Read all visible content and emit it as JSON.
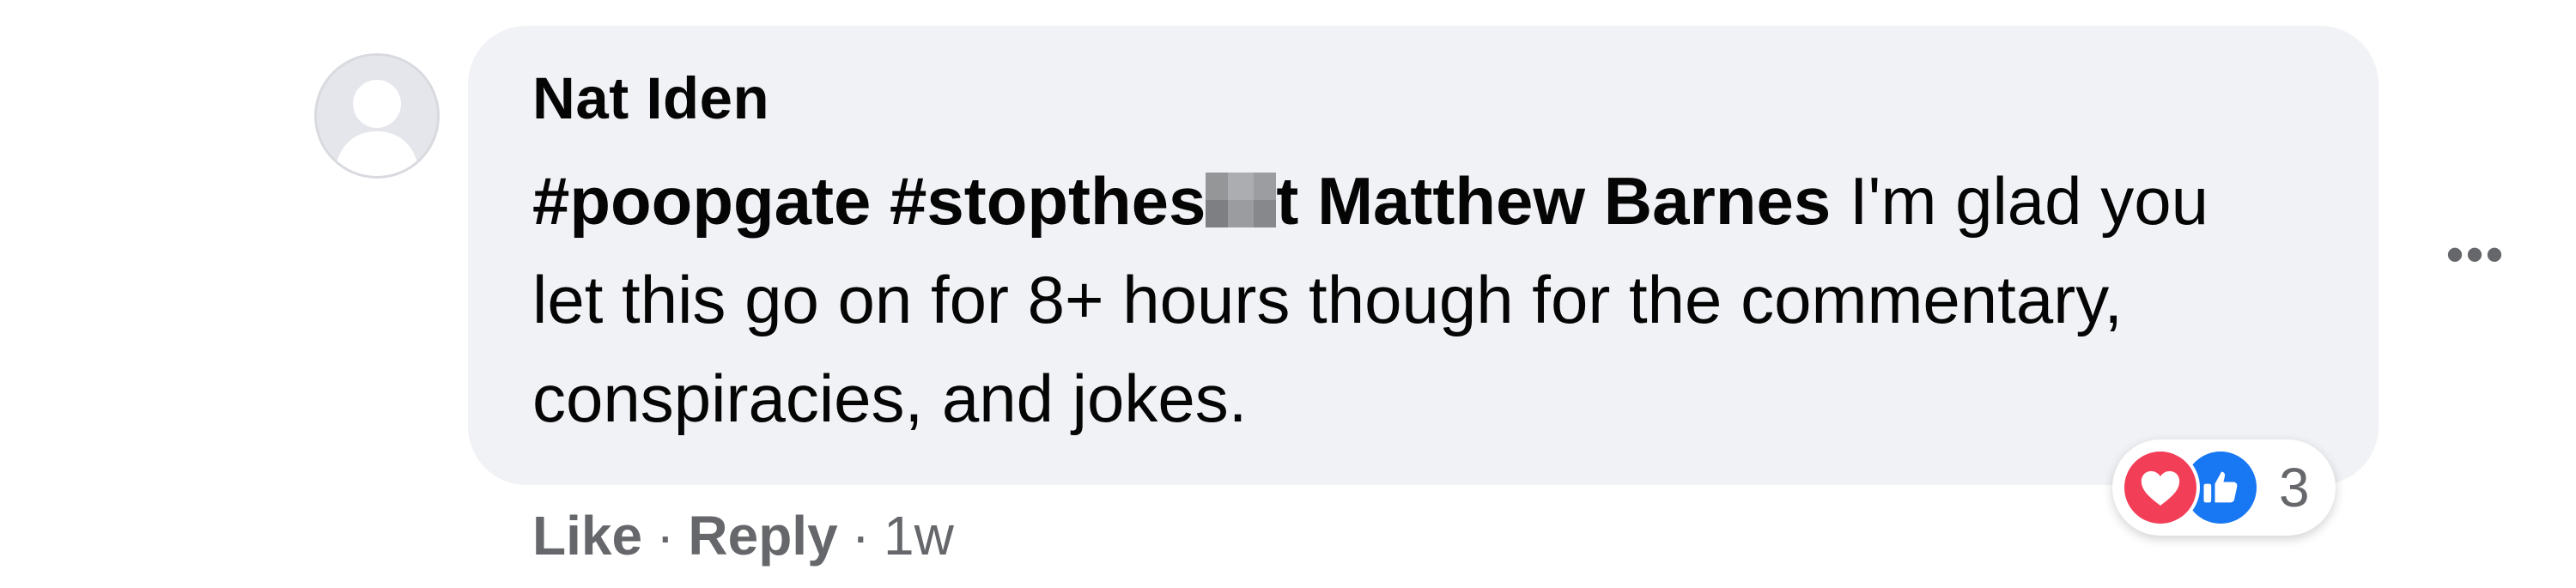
{
  "comment": {
    "author": "Nat Iden",
    "text": {
      "hashtag_1": "#poopgate",
      "hashtag_2_start": "#stopthes",
      "hashtag_2_end": "t",
      "mention": "Matthew Barnes",
      "body": " I'm glad you let this go on for 8+ hours though for the commentary, conspiracies, and jokes."
    },
    "more_icon": "•••",
    "reactions": {
      "icons": [
        "heart-icon",
        "thumbs-up-icon"
      ],
      "count": "3",
      "colors": {
        "love": "#f33e58",
        "like": "#1877f2"
      }
    },
    "actions": {
      "like": "Like",
      "reply": "Reply",
      "separator": "·",
      "timestamp": "1w"
    }
  },
  "colors": {
    "bubble_bg": "#f0f2f5",
    "text": "#050505",
    "secondary_text": "#65676b"
  }
}
